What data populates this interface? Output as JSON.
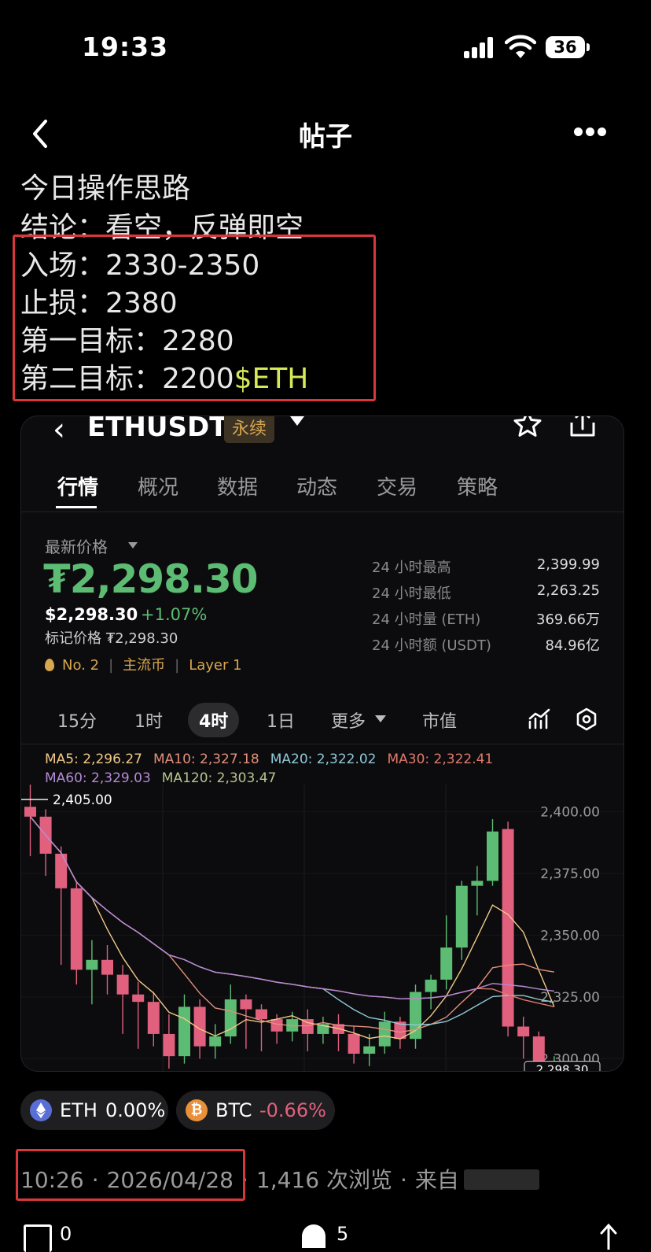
{
  "status_bar": {
    "time": "19:33",
    "battery": "36"
  },
  "header": {
    "title": "帖子"
  },
  "post": {
    "line1": "今日操作思路",
    "line2": "结论：看空，反弹即空",
    "entry_label": "入场：",
    "entry_value": "2330-2350",
    "stop_label": "止损：",
    "stop_value": "2380",
    "target1_label": "第一目标：",
    "target1_value": "2280",
    "target2_label": "第二目标：",
    "target2_value": "2200",
    "tag": "$ETH"
  },
  "card": {
    "pair": "ETHUSDT",
    "badge": "永续",
    "tabs": [
      "行情",
      "概况",
      "数据",
      "动态",
      "交易",
      "策略"
    ],
    "latest_price_label": "最新价格",
    "price": "₮2,298.30",
    "usd_price": "$2,298.30",
    "change": "+1.07%",
    "mark_price": "标记价格 ₮2,298.30",
    "rank": "No. 2",
    "category": "主流币",
    "layer": "Layer 1",
    "stats": [
      {
        "label": "24 小时最高",
        "value": "2,399.99"
      },
      {
        "label": "24 小时最低",
        "value": "2,263.25"
      },
      {
        "label": "24 小时量 (ETH)",
        "value": "369.66万"
      },
      {
        "label": "24 小时额 (USDT)",
        "value": "84.96亿"
      }
    ],
    "timeframes": [
      "15分",
      "1时",
      "4时",
      "1日",
      "更多",
      "市值"
    ],
    "ma": {
      "ma5": "MA5: 2,296.27",
      "ma10": "MA10: 2,327.18",
      "ma20": "MA20: 2,322.02",
      "ma30": "MA30: 2,322.41",
      "ma60": "MA60: 2,329.03",
      "ma120": "MA120: 2,303.47"
    },
    "colors": {
      "up": "#5cbc73",
      "down": "#e0607e",
      "ma5": "#f0c987",
      "ma10": "#e28f7a",
      "ma20": "#8fc9d8",
      "ma30": "#e07a6a",
      "ma60": "#b48ad6",
      "ma120": "#b6c48e"
    }
  },
  "chart_data": {
    "type": "candlestick",
    "y_ticks": [
      "2,400.00",
      "2,375.00",
      "2,350.00",
      "2,325.00",
      "2,300.00"
    ],
    "ylim": [
      2295,
      2411
    ],
    "high_marker": "2,405.00",
    "current_price_tag": "2,298.30",
    "candles": [
      [
        2402,
        2398,
        2411,
        2382
      ],
      [
        2398,
        2383,
        2401,
        2374
      ],
      [
        2383,
        2369,
        2386,
        2338
      ],
      [
        2369,
        2336,
        2372,
        2330
      ],
      [
        2336,
        2340,
        2348,
        2322
      ],
      [
        2340,
        2334,
        2346,
        2326
      ],
      [
        2334,
        2326,
        2338,
        2310
      ],
      [
        2326,
        2323,
        2331,
        2304
      ],
      [
        2323,
        2310,
        2327,
        2305
      ],
      [
        2310,
        2301,
        2318,
        2296
      ],
      [
        2301,
        2321,
        2326,
        2298
      ],
      [
        2321,
        2305,
        2324,
        2300
      ],
      [
        2305,
        2309,
        2314,
        2300
      ],
      [
        2309,
        2324,
        2330,
        2306
      ],
      [
        2324,
        2320,
        2326,
        2304
      ],
      [
        2320,
        2316,
        2322,
        2303
      ],
      [
        2316,
        2311,
        2318,
        2306
      ],
      [
        2311,
        2316,
        2319,
        2307
      ],
      [
        2316,
        2310,
        2320,
        2303
      ],
      [
        2310,
        2314,
        2317,
        2306
      ],
      [
        2314,
        2310,
        2318,
        2303
      ],
      [
        2310,
        2302,
        2313,
        2298
      ],
      [
        2302,
        2305,
        2310,
        2297
      ],
      [
        2305,
        2315,
        2319,
        2302
      ],
      [
        2315,
        2308,
        2317,
        2304
      ],
      [
        2308,
        2327,
        2330,
        2304
      ],
      [
        2327,
        2332,
        2334,
        2320
      ],
      [
        2332,
        2345,
        2358,
        2328
      ],
      [
        2345,
        2370,
        2372,
        2340
      ],
      [
        2370,
        2372,
        2378,
        2358
      ],
      [
        2372,
        2392,
        2397,
        2370
      ],
      [
        2393,
        2313,
        2396,
        2309
      ],
      [
        2313,
        2309,
        2317,
        2300
      ],
      [
        2309,
        2293,
        2311,
        2290
      ],
      [
        2293,
        2298,
        2301,
        2293
      ]
    ]
  },
  "chips": [
    {
      "symbol": "ETH",
      "change": "0.00%"
    },
    {
      "symbol": "BTC",
      "change": "-0.66%"
    }
  ],
  "meta": {
    "time": "10:26",
    "date": "2026/04/28",
    "views": "1,416 次浏览",
    "source": "来自"
  },
  "bottom": {
    "comments": "0",
    "likes": "5"
  }
}
